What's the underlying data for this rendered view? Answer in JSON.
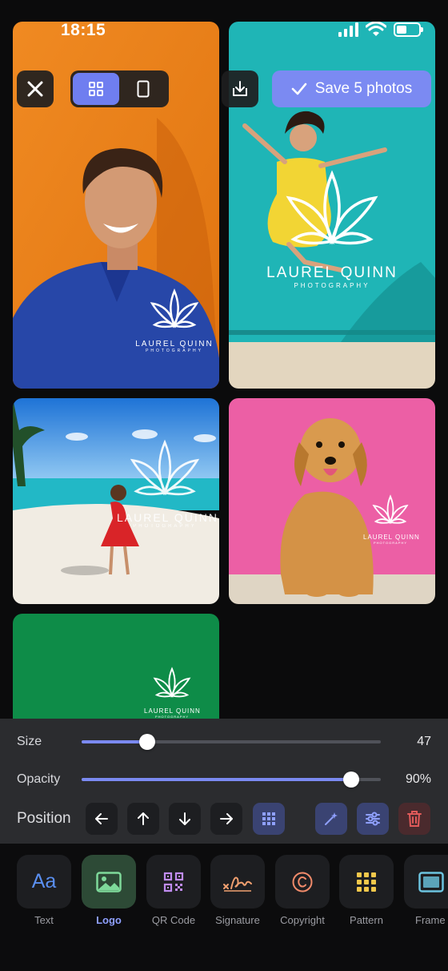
{
  "status_bar": {
    "time": "18:15"
  },
  "toolbar": {
    "save_label": "Save 5 photos"
  },
  "watermark": {
    "name": "LAUREL QUINN",
    "subtitle": "PHOTOGRAPHY"
  },
  "adjust": {
    "size_label": "Size",
    "size_value": "47",
    "size_fraction": 0.22,
    "opacity_label": "Opacity",
    "opacity_value": "90%",
    "opacity_fraction": 0.9,
    "position_label": "Position"
  },
  "tools": [
    {
      "label": "Text",
      "icon": "text-aa-icon"
    },
    {
      "label": "Logo",
      "icon": "image-icon",
      "active": true
    },
    {
      "label": "QR Code",
      "icon": "qr-code-icon"
    },
    {
      "label": "Signature",
      "icon": "signature-icon"
    },
    {
      "label": "Copyright",
      "icon": "copyright-icon"
    },
    {
      "label": "Pattern",
      "icon": "pattern-grid-icon"
    },
    {
      "label": "Frame",
      "icon": "frame-icon"
    }
  ],
  "colors": {
    "accent": "#7b8af2",
    "panel": "#2b2c2f",
    "active_tool": "#2d4a36",
    "delete": "#e05a5a"
  }
}
